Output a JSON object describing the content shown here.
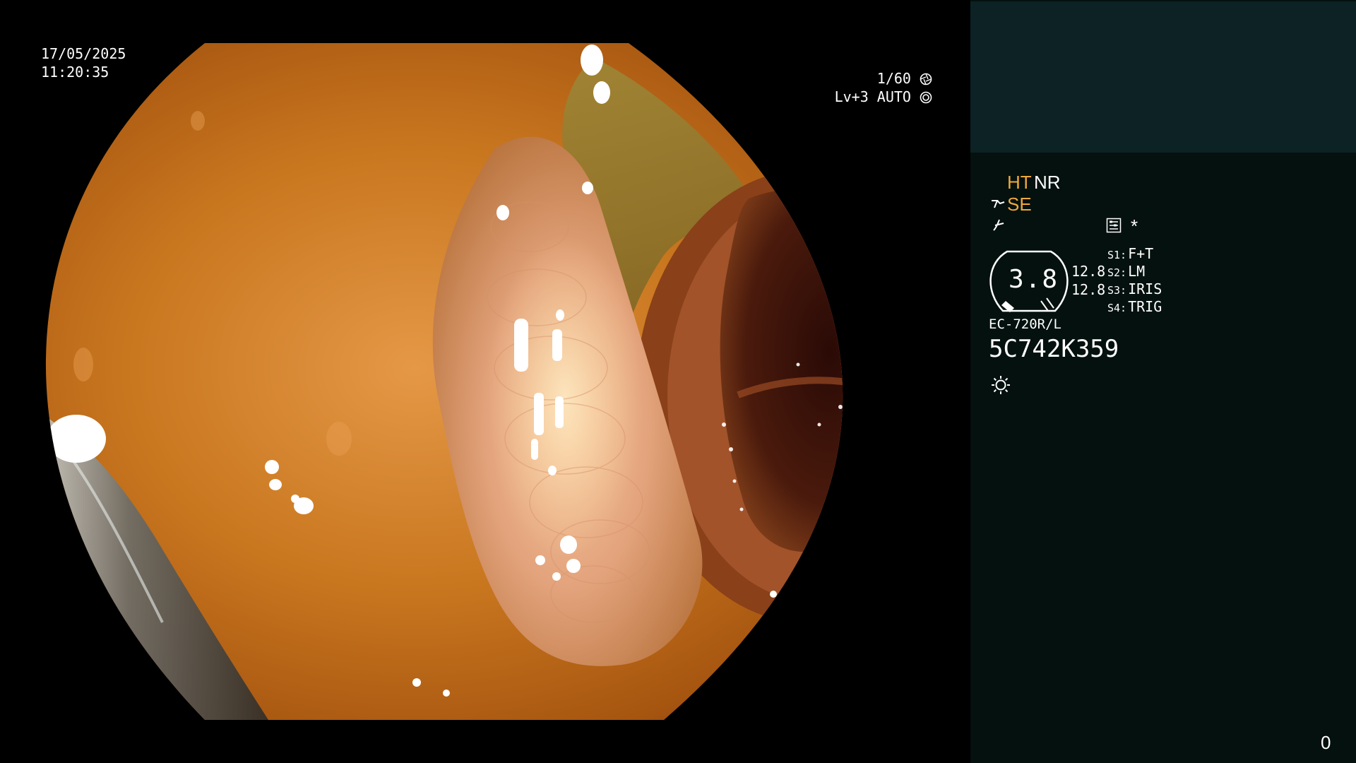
{
  "overlay": {
    "date": "17/05/2025",
    "time": "11:20:35",
    "shutter": "1/60",
    "exposure": "Lv+3 AUTO"
  },
  "panel": {
    "mode_ht": "HT",
    "mode_nr": "NR",
    "mode_se": "SE",
    "asterisk": "*",
    "zoom_value": "3.8",
    "zoom_scale_1": "12.8",
    "zoom_scale_2": "12.8",
    "switches": [
      {
        "key": "S1:",
        "value": "F+T"
      },
      {
        "key": "S2:",
        "value": "LM"
      },
      {
        "key": "S3:",
        "value": "IRIS"
      },
      {
        "key": "S4:",
        "value": "TRIG"
      }
    ],
    "scope_model": "EC-720R/L",
    "scope_serial": "5C742K359",
    "page_counter": "0"
  },
  "colors": {
    "accent_orange": "#f0a83a",
    "panel_bg": "#04110f",
    "panel_top_bg": "#0c2224"
  },
  "icons": [
    "aperture-icon",
    "iris-icon",
    "enhancement-icon",
    "structure-icon",
    "menu-icon",
    "light-icon"
  ]
}
